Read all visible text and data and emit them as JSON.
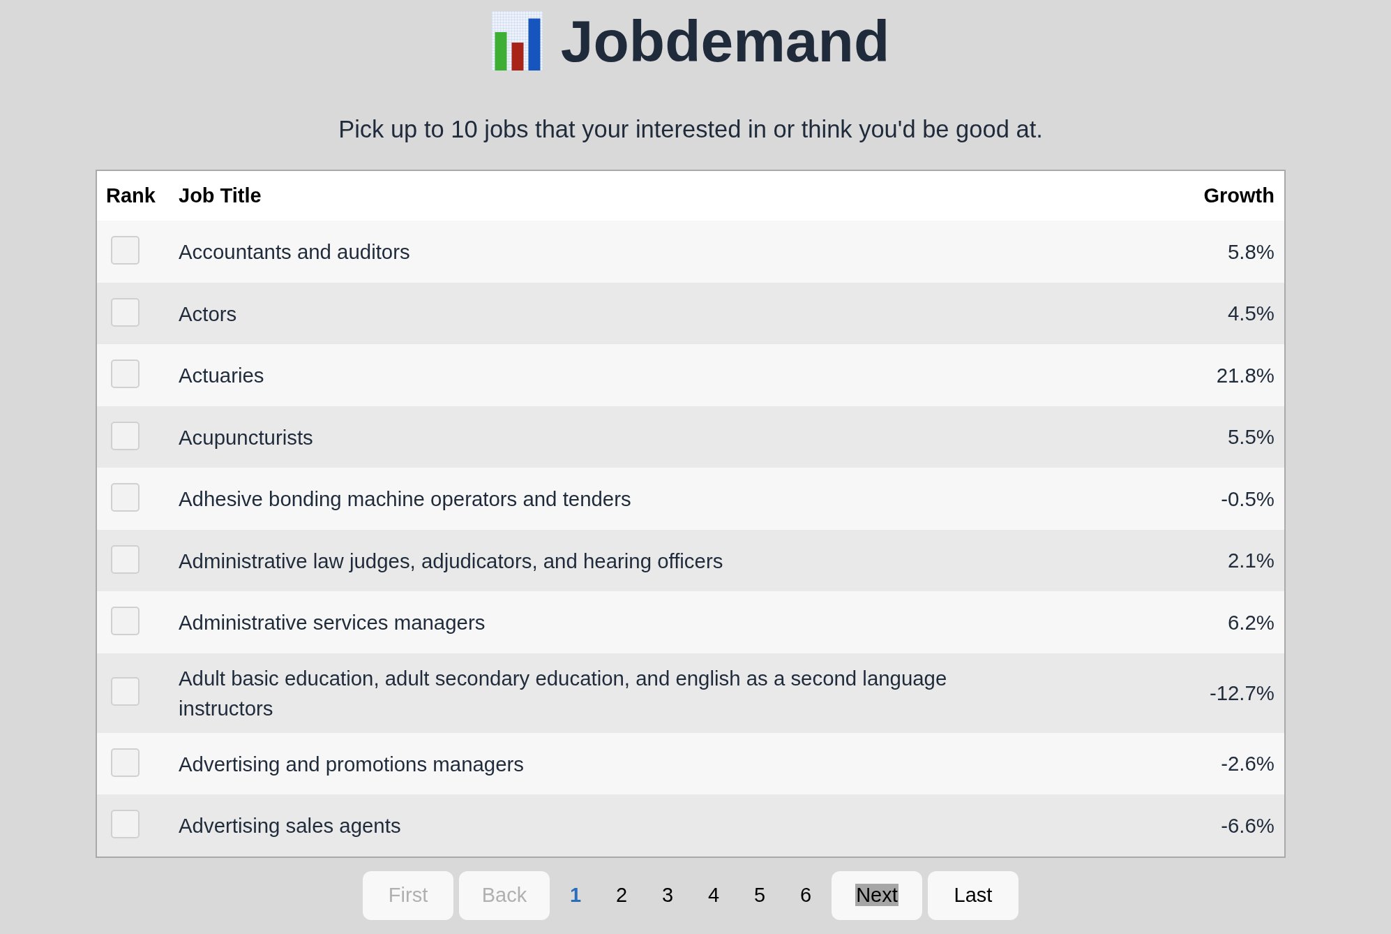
{
  "header": {
    "title": "Jobdemand",
    "subtitle": "Pick up to 10 jobs that your interested in or think you'd be good at."
  },
  "table": {
    "columns": [
      "Rank",
      "Job Title",
      "Growth"
    ],
    "rows": [
      {
        "checked": false,
        "title": "Accountants and auditors",
        "growth": "5.8%"
      },
      {
        "checked": false,
        "title": "Actors",
        "growth": "4.5%"
      },
      {
        "checked": false,
        "title": "Actuaries",
        "growth": "21.8%"
      },
      {
        "checked": false,
        "title": "Acupuncturists",
        "growth": "5.5%"
      },
      {
        "checked": false,
        "title": "Adhesive bonding machine operators and tenders",
        "growth": "-0.5%"
      },
      {
        "checked": false,
        "title": "Administrative law judges, adjudicators, and hearing officers",
        "growth": "2.1%"
      },
      {
        "checked": false,
        "title": "Administrative services managers",
        "growth": "6.2%"
      },
      {
        "checked": false,
        "title": "Adult basic education, adult secondary education, and english as a second language instructors",
        "growth": "-12.7%"
      },
      {
        "checked": false,
        "title": "Advertising and promotions managers",
        "growth": "-2.6%"
      },
      {
        "checked": false,
        "title": "Advertising sales agents",
        "growth": "-6.6%"
      }
    ]
  },
  "pagination": {
    "prev_buttons": [
      {
        "label": "First",
        "disabled": true,
        "highlighted": false
      },
      {
        "label": "Back",
        "disabled": true,
        "highlighted": false
      }
    ],
    "pages": [
      {
        "label": "1",
        "selected": true
      },
      {
        "label": "2",
        "selected": false
      },
      {
        "label": "3",
        "selected": false
      },
      {
        "label": "4",
        "selected": false
      },
      {
        "label": "5",
        "selected": false
      },
      {
        "label": "6",
        "selected": false
      }
    ],
    "next_buttons": [
      {
        "label": "Next",
        "disabled": false,
        "highlighted": true
      },
      {
        "label": "Last",
        "disabled": false,
        "highlighted": false
      }
    ]
  }
}
